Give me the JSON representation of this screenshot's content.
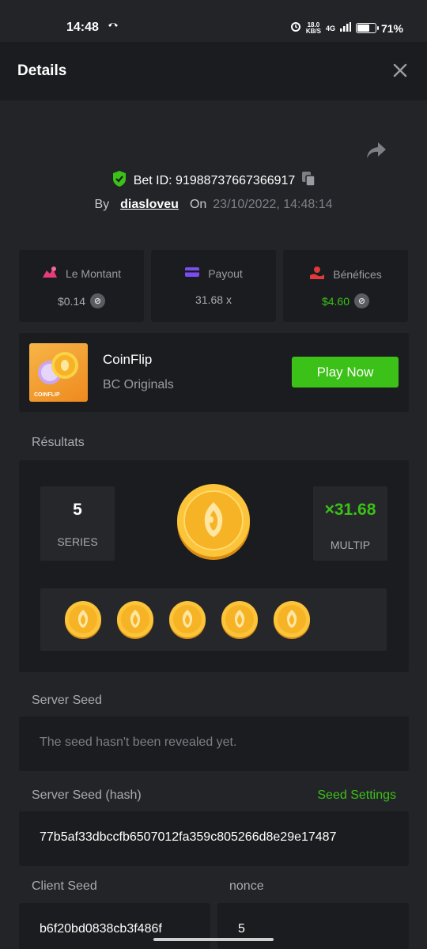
{
  "status_bar": {
    "time": "14:48",
    "net_speed_top": "18.0",
    "net_speed_bottom": "KB/S",
    "signal": "4G",
    "battery_percent": "71%",
    "battery_level": 0.71
  },
  "header": {
    "title": "Details"
  },
  "bet": {
    "id_label": "Bet ID: 91988737667366917",
    "by_label": "By",
    "user": "diasloveu",
    "on_label": "On",
    "date": "23/10/2022, 14:48:14"
  },
  "stats": {
    "amount": {
      "label": "Le Montant",
      "value": "$0.14"
    },
    "payout": {
      "label": "Payout",
      "value": "31.68 x"
    },
    "profit": {
      "label": "Bénéfices",
      "value": "$4.60"
    }
  },
  "game": {
    "thumb_label": "COINFLIP",
    "name": "CoinFlip",
    "provider": "BC Originals",
    "play_label": "Play Now"
  },
  "results": {
    "title": "Résultats",
    "series_value": "5",
    "series_label": "SERIES",
    "multiplier_value": "×31.68",
    "multiplier_label": "MULTIP",
    "coin_count": 5
  },
  "server_seed": {
    "label": "Server Seed",
    "value": "The seed hasn't been revealed yet."
  },
  "server_seed_hash": {
    "label": "Server Seed (hash)",
    "settings_label": "Seed Settings",
    "value": "77b5af33dbccfb6507012fa359c805266d8e29e17487"
  },
  "client_seed": {
    "label": "Client Seed",
    "value": "b6f20bd0838cb3f486f"
  },
  "nonce": {
    "label": "nonce",
    "value": "5"
  },
  "colors": {
    "accent_green": "#3bc117",
    "background": "#232428",
    "card": "#1b1c1f"
  }
}
